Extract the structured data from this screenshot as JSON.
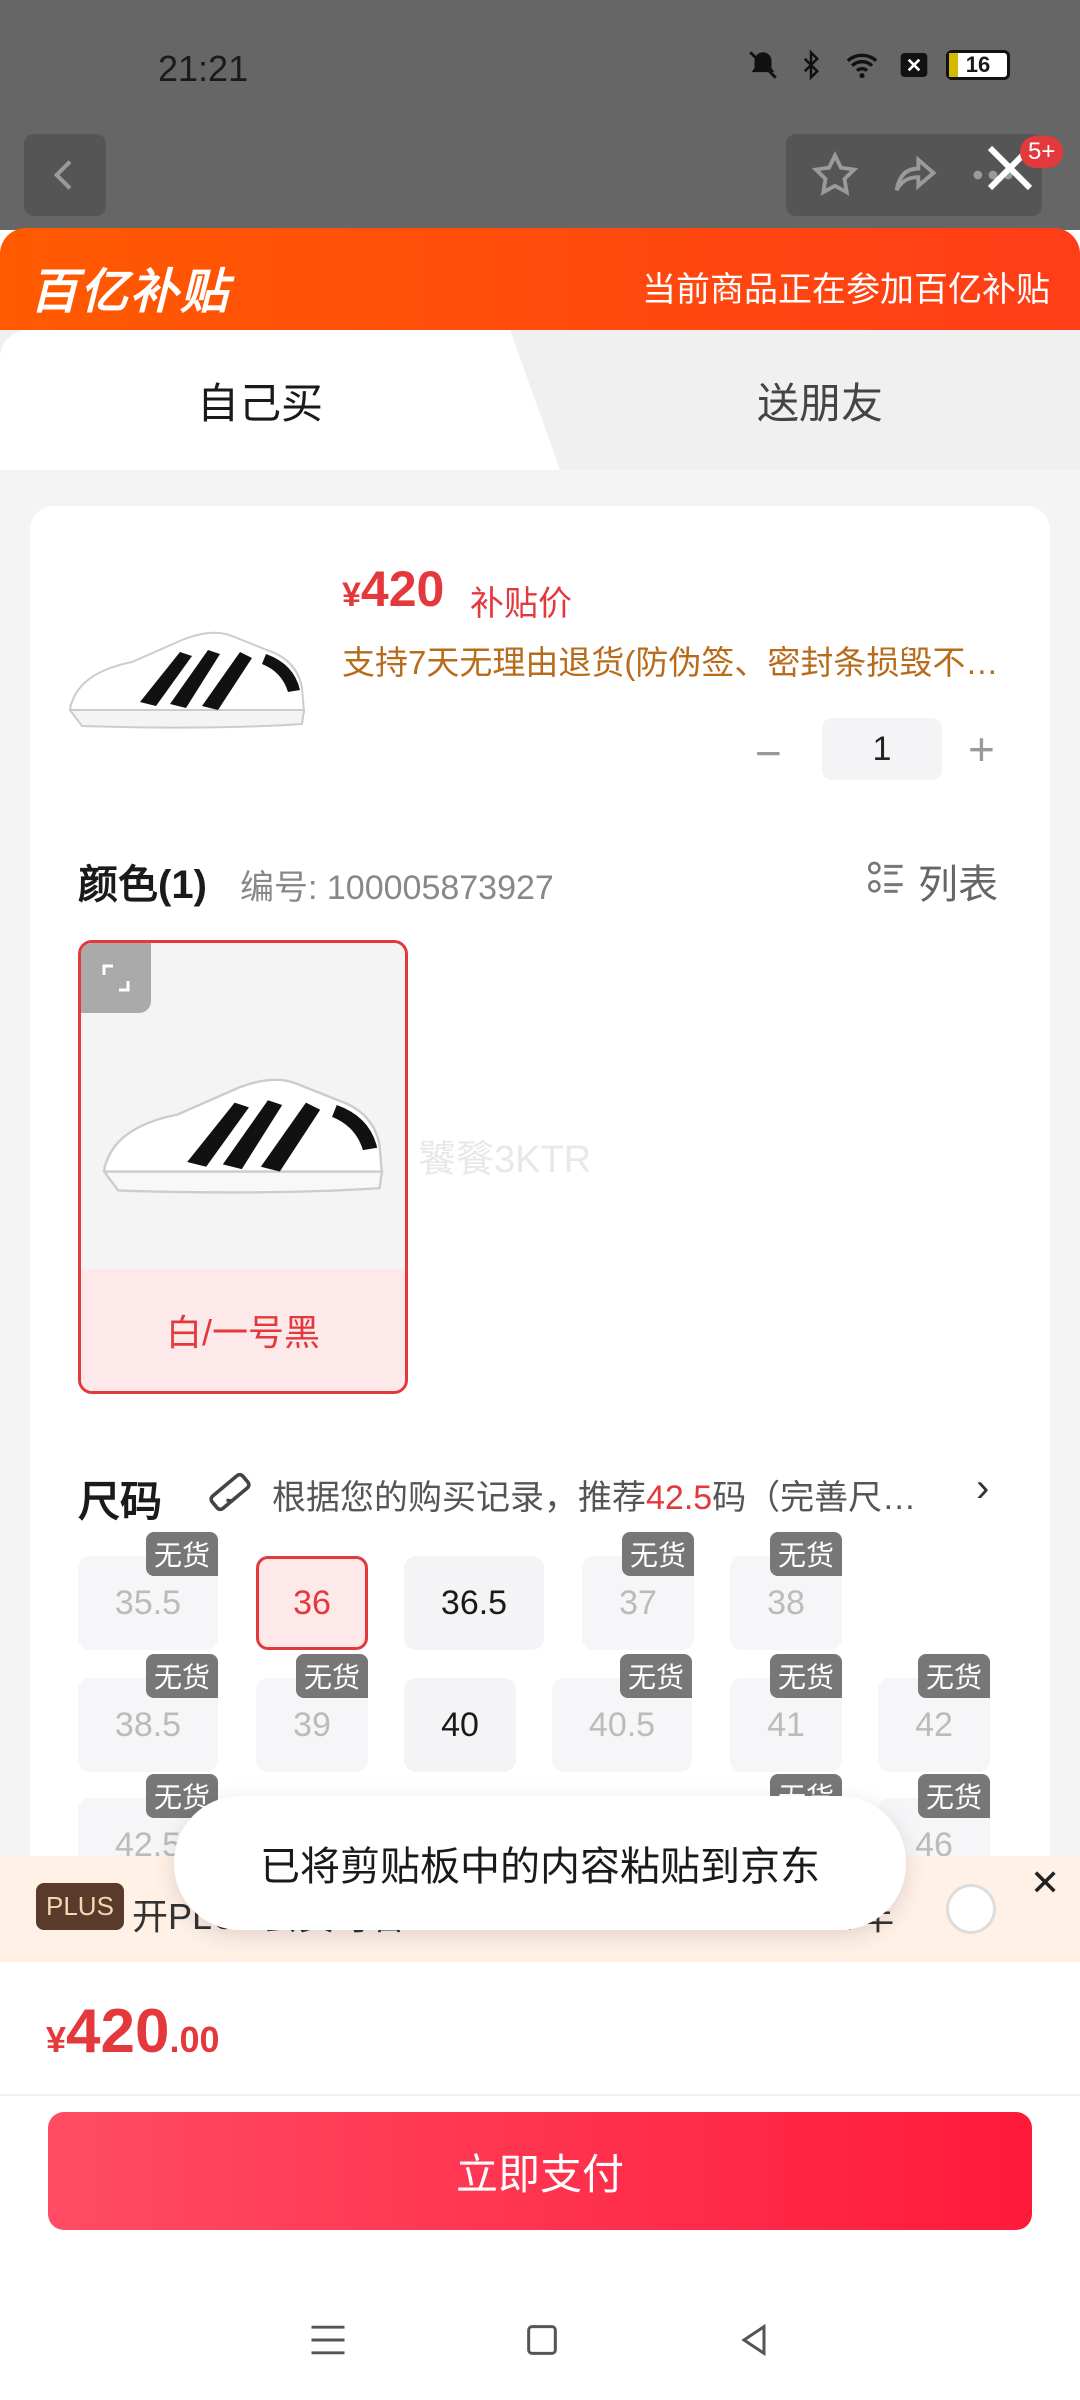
{
  "status_bar": {
    "time": "21:21",
    "battery": "16"
  },
  "header": {
    "badge": "5+"
  },
  "banner": {
    "logo": "百亿补贴",
    "text": "当前商品正在参加百亿补贴"
  },
  "tabs": [
    {
      "label": "自己买"
    },
    {
      "label": "送朋友"
    }
  ],
  "product": {
    "currency": "¥",
    "price": "420",
    "price_tag": "补贴价",
    "subtitle": "支持7天无理由退货(防伪签、密封条损毁不…",
    "quantity": "1",
    "minus": "−",
    "plus": "+"
  },
  "color_section": {
    "heading": "颜色(1)",
    "code_label": "编号: 100005873927",
    "list_label": "列表",
    "swatch_label": "白/一号黑",
    "watermark": "饕餮3KTR"
  },
  "size_section": {
    "heading": "尺码",
    "rec_prefix": "根据您的购买记录，推荐",
    "rec_size": "42.5",
    "rec_suffix": "码（完善尺…",
    "chevron": "›",
    "sold_out": "无货",
    "sizes": [
      {
        "label": "35.5",
        "stock": "无货"
      },
      {
        "label": "36"
      },
      {
        "label": "36.5"
      },
      {
        "label": "37",
        "stock": "无货"
      },
      {
        "label": "38",
        "stock": "无货"
      },
      {
        "label": "38.5",
        "stock": "无货"
      },
      {
        "label": "39",
        "stock": "无货"
      },
      {
        "label": "40"
      },
      {
        "label": "40.5",
        "stock": "无货"
      },
      {
        "label": "41",
        "stock": "无货"
      },
      {
        "label": "42",
        "stock": "无货"
      },
      {
        "label": "42.5",
        "stock": "无货"
      },
      {
        "label": "46",
        "stock": "无货"
      }
    ]
  },
  "plus_bar": {
    "tag": "PLUS",
    "text": "开PLUS会员可省¥30 ›",
    "price": "¥99/年",
    "close": "✕"
  },
  "toast": {
    "text": "已将剪贴板中的内容粘贴到京东"
  },
  "footer": {
    "currency": "¥",
    "total_int": "420",
    "total_dec": ".00",
    "pay_label": "立即支付"
  },
  "colors": {
    "accent": "#e4393c",
    "banner": "#ff5a00",
    "pay": "#ff1a3a"
  }
}
